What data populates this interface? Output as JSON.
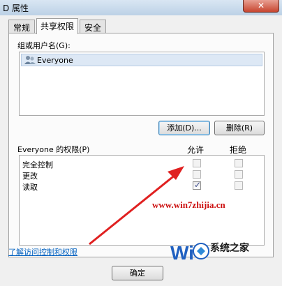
{
  "window": {
    "title": "D 属性"
  },
  "tabs": [
    {
      "label": "常规",
      "active": false
    },
    {
      "label": "共享权限",
      "active": true
    },
    {
      "label": "安全",
      "active": false
    }
  ],
  "group_label": "组或用户名(G):",
  "users": [
    {
      "name": "Everyone",
      "icon": "users-icon",
      "selected": true
    }
  ],
  "buttons": {
    "add": "添加(D)...",
    "remove": "删除(R)",
    "ok": "确定"
  },
  "permissions": {
    "title": "Everyone 的权限(P)",
    "allow_header": "允许",
    "deny_header": "拒绝",
    "rows": [
      {
        "name": "完全控制",
        "allow": false,
        "deny": false
      },
      {
        "name": "更改",
        "allow": false,
        "deny": false
      },
      {
        "name": "读取",
        "allow": true,
        "deny": false
      }
    ]
  },
  "link": "了解访问控制和权限",
  "watermark": {
    "url": "www.win7zhijia.cn",
    "text": "系统之家"
  },
  "colors": {
    "arrow": "#e02020",
    "link": "#0060c0",
    "close": "#c7452f"
  }
}
